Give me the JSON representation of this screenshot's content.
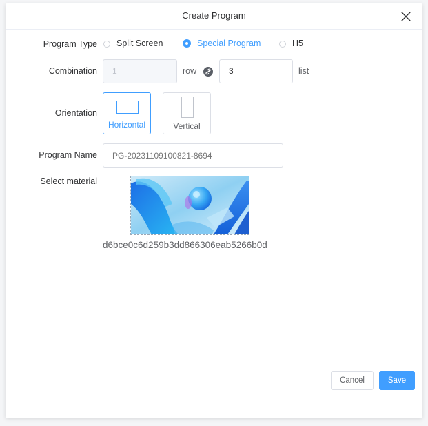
{
  "dialog": {
    "title": "Create Program",
    "close_icon": "close-icon"
  },
  "program_type": {
    "label": "Program Type",
    "options": [
      {
        "label": "Split Screen",
        "checked": false
      },
      {
        "label": "Special Program",
        "checked": true
      },
      {
        "label": "H5",
        "checked": false
      }
    ]
  },
  "combination": {
    "label": "Combination",
    "rows_value": "1",
    "row_label": "row",
    "link_icon": "link-icon",
    "list_value": "3",
    "list_label": "list"
  },
  "orientation": {
    "label": "Orientation",
    "options": [
      {
        "label": "Horizontal",
        "active": true
      },
      {
        "label": "Vertical",
        "active": false
      }
    ]
  },
  "program_name": {
    "label": "Program Name",
    "placeholder": "PG-20231109100821-8694"
  },
  "material": {
    "label": "Select material",
    "id": "d6bce0c6d259b3dd866306eab5266b0d"
  },
  "footer": {
    "cancel_label": "Cancel",
    "save_label": "Save"
  },
  "colors": {
    "accent": "#409eff",
    "border": "#dcdfe6",
    "text": "#303133"
  }
}
